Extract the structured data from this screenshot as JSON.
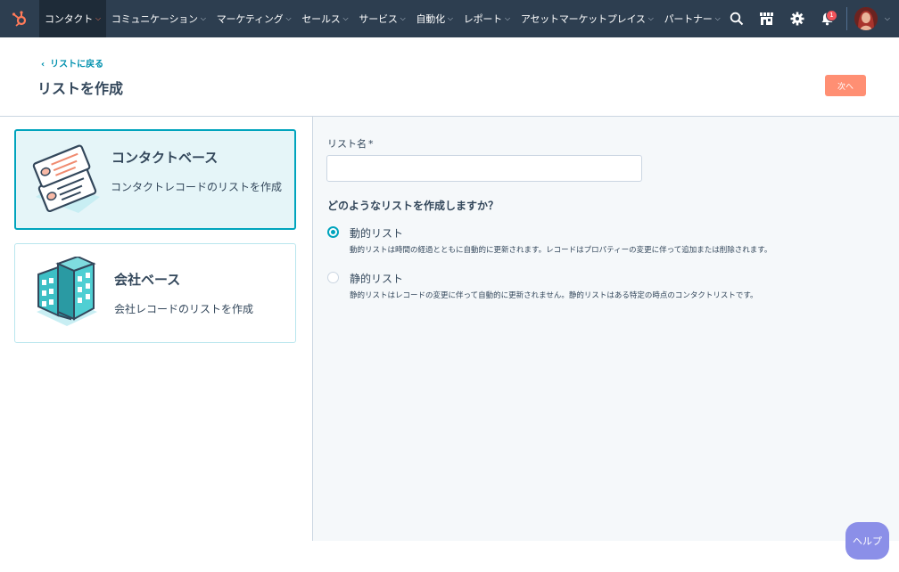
{
  "topnav": {
    "items": [
      {
        "label": "コンタクト"
      },
      {
        "label": "コミュニケーション"
      },
      {
        "label": "マーケティング"
      },
      {
        "label": "セールス"
      },
      {
        "label": "サービス"
      },
      {
        "label": "自動化"
      },
      {
        "label": "レポート"
      },
      {
        "label": "アセットマーケットプレイス"
      },
      {
        "label": "パートナー"
      }
    ],
    "notification_count": "1",
    "colors": {
      "bar": "#2d3e50",
      "accent": "#ff7a59"
    }
  },
  "header": {
    "back_label": "リストに戻る",
    "title": "リストを作成",
    "next_label": "次へ"
  },
  "cards": [
    {
      "title": "コンタクトベース",
      "description": "コンタクトレコードのリストを作成",
      "selected": true,
      "icon": "contact-cards-illustration"
    },
    {
      "title": "会社ベース",
      "description": "会社レコードのリストを作成",
      "selected": false,
      "icon": "company-building-illustration"
    }
  ],
  "form": {
    "name_label": "リスト名",
    "required_mark": "*",
    "name_value": "",
    "question": "どのようなリストを作成しますか？",
    "options": [
      {
        "label": "動的リスト",
        "help": "動的リストは時間の経過とともに自動的に更新されます。レコードはプロパティーの変更に伴って追加または削除されます。",
        "checked": true
      },
      {
        "label": "静的リスト",
        "help": "静的リストはレコードの変更に伴って自動的に更新されません。静的リストはある特定の時点のコンタクトリストです。",
        "checked": false
      }
    ]
  },
  "help": {
    "label": "ヘルプ"
  }
}
